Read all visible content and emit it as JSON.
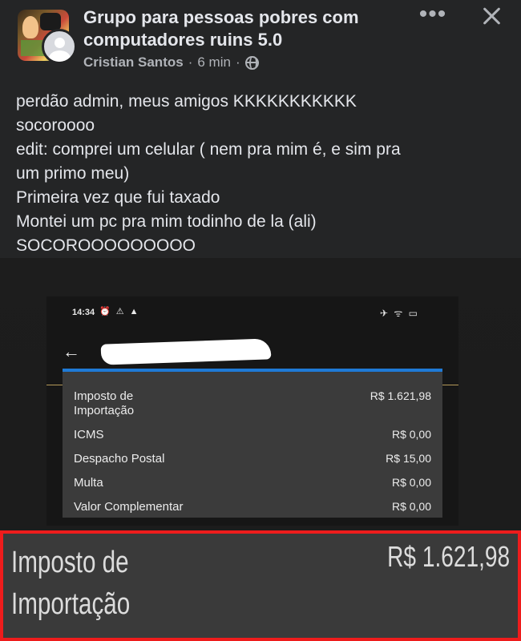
{
  "header": {
    "group_name": "Grupo para pessoas pobres com computadores ruins 5.0",
    "author": "Cristian Santos",
    "separator": "·",
    "time": "6 min",
    "separator2": "·",
    "more_icon": "more-dots-icon",
    "close_icon": "close-icon",
    "privacy_icon": "globe-icon"
  },
  "post": {
    "lines": [
      "perdão admin,  meus amigos KKKKKKKKKKK",
      "socoroooo",
      "edit: comprei um celular ( nem pra mim é, e sim pra",
      "um primo meu)",
      "Primeira vez que fui taxado",
      "Montei um pc pra mim todinho de la (ali)",
      "SOCOROOOOOOOOO"
    ]
  },
  "screenshot": {
    "status_time": "14:34",
    "status_left_icons": "⏰ ⚠ ▲",
    "status_right_icons": "✈ ᯤ ▭",
    "back_icon": "arrow-left-icon",
    "rows": [
      {
        "label": "Imposto de Importação",
        "value": "R$ 1.621,98"
      },
      {
        "label": "ICMS",
        "value": "R$ 0,00"
      },
      {
        "label": "Despacho Postal",
        "value": "R$ 15,00"
      },
      {
        "label": "Multa",
        "value": "R$ 0,00"
      },
      {
        "label": "Valor Complementar",
        "value": "R$ 0,00"
      }
    ],
    "accent_color": "#1f7ad6"
  },
  "zoom": {
    "label_line1": "Imposto de",
    "label_line2": "Importação",
    "value": "R$ 1.621,98",
    "border_color": "#ee1c1c"
  }
}
